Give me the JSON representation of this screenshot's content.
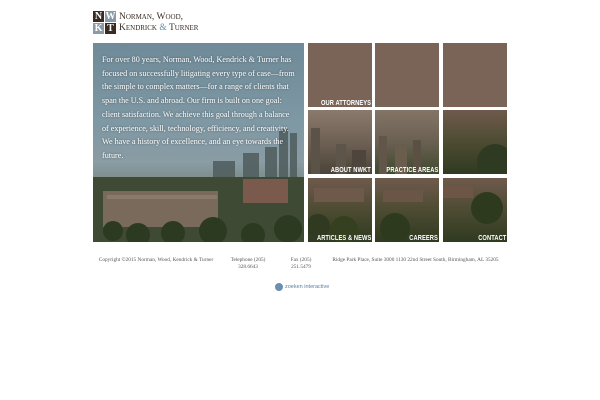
{
  "logo": {
    "letters": [
      "N",
      "W",
      "K",
      "T"
    ],
    "line1": "Norman, Wood,",
    "line2_a": "Kendrick ",
    "line2_amp": "&",
    "line2_b": " Turner"
  },
  "hero": {
    "text": "For over 80 years, Norman, Wood, Kendrick & Turner has focused on successfully litigating every type of case—from the simple to complex matters—for a range of clients that span the U.S. and abroad. Our firm is built on one goal: client satisfaction. We achieve this goal through a balance of experience, skill, technology, efficiency, and creativity. We have a history of excellence, and an eye towards the future."
  },
  "tiles": [
    {
      "label": "Our Attorneys"
    },
    {
      "label": ""
    },
    {
      "label": ""
    },
    {
      "label": "About NWKT"
    },
    {
      "label": "Practice Areas"
    },
    {
      "label": ""
    },
    {
      "label": "Articles & News"
    },
    {
      "label": "Careers"
    },
    {
      "label": "Contact"
    }
  ],
  "footer": {
    "copyright": "Copyright ©2015 Norman, Wood, Kendrick & Turner",
    "telephone": "Telephone (205) 328.6643",
    "fax": "Fax (205) 251.5479",
    "address": "Ridge Park Place, Suite 3000 1130 22nd Street South, Birmingham, AL 35205",
    "credit": "zoeken interactive"
  },
  "colors": {
    "brand_dark": "#3a2a22",
    "brand_blue": "#6b8fb0",
    "tile_overlay": "#7a6457"
  }
}
